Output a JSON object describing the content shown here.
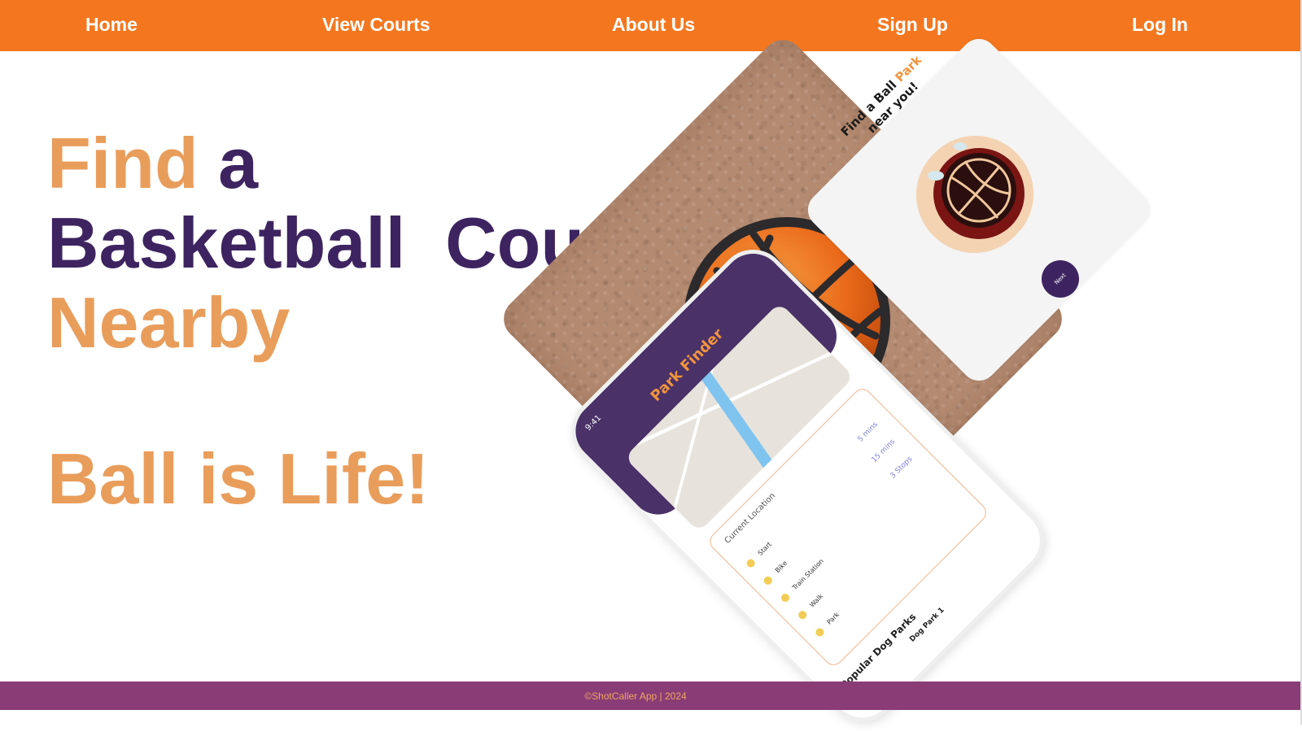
{
  "nav": {
    "items": [
      {
        "label": "Home"
      },
      {
        "label": "View Courts"
      },
      {
        "label": "About Us"
      },
      {
        "label": "Sign Up"
      },
      {
        "label": "Log In"
      }
    ]
  },
  "hero": {
    "word_find": "Find",
    "word_a": "a",
    "line2": "Basketball  Court",
    "line3": "Nearby",
    "tagline": "Ball is Life!"
  },
  "onboard": {
    "title_part1": "Find a Ball ",
    "title_highlight": "Park",
    "title_part2": "near you!",
    "next_label": "Next"
  },
  "phone": {
    "time": "9:41",
    "app_title": "Park Finder",
    "location_label": "Current Location",
    "route_steps": [
      "Start",
      "Bike",
      "Train Station",
      "Walk",
      "Park"
    ],
    "distances": [
      "5 mins",
      "15 mins",
      "3 Stops"
    ],
    "section_title": "Popular Dog Parks",
    "card_title": "Dog Park 1"
  },
  "footer": {
    "text": "©ShotCaller App | 2024"
  },
  "colors": {
    "nav_bg": "#f4771f",
    "footer_bg": "#8a3c76",
    "accent_orange": "#e99d5b",
    "accent_purple": "#3d2460"
  }
}
